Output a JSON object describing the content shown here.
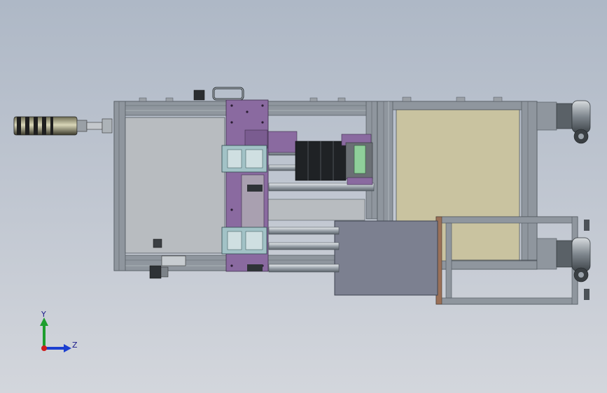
{
  "view": {
    "background_top": "#aeb8c6",
    "background_bottom": "#d3d6dc",
    "model_description_hidden": true
  },
  "triad": {
    "y_label": "Y",
    "z_label": "Z",
    "y_color": "#1e9e2e",
    "z_color": "#1c3fd0",
    "x_color": "#d01c1c"
  },
  "colors": {
    "frame": "#8f969e",
    "frame_dark": "#4e555c",
    "purple_plate": "#8a6aa0",
    "beige_panel": "#c9c3a0",
    "slate_box": "#7c8090",
    "motor_dark": "#2c2c28",
    "green_part": "#8fcf9a"
  }
}
